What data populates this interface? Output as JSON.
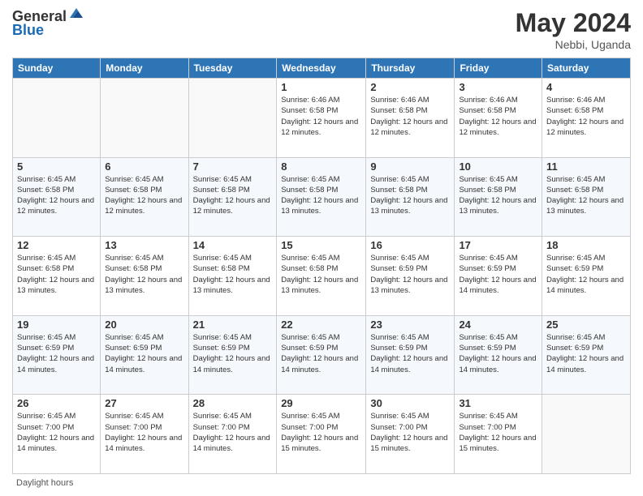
{
  "header": {
    "logo_general": "General",
    "logo_blue": "Blue",
    "month_year": "May 2024",
    "location": "Nebbi, Uganda"
  },
  "days_of_week": [
    "Sunday",
    "Monday",
    "Tuesday",
    "Wednesday",
    "Thursday",
    "Friday",
    "Saturday"
  ],
  "weeks": [
    [
      {
        "day": "",
        "info": ""
      },
      {
        "day": "",
        "info": ""
      },
      {
        "day": "",
        "info": ""
      },
      {
        "day": "1",
        "info": "Sunrise: 6:46 AM\nSunset: 6:58 PM\nDaylight: 12 hours\nand 12 minutes."
      },
      {
        "day": "2",
        "info": "Sunrise: 6:46 AM\nSunset: 6:58 PM\nDaylight: 12 hours\nand 12 minutes."
      },
      {
        "day": "3",
        "info": "Sunrise: 6:46 AM\nSunset: 6:58 PM\nDaylight: 12 hours\nand 12 minutes."
      },
      {
        "day": "4",
        "info": "Sunrise: 6:46 AM\nSunset: 6:58 PM\nDaylight: 12 hours\nand 12 minutes."
      }
    ],
    [
      {
        "day": "5",
        "info": "Sunrise: 6:45 AM\nSunset: 6:58 PM\nDaylight: 12 hours\nand 12 minutes."
      },
      {
        "day": "6",
        "info": "Sunrise: 6:45 AM\nSunset: 6:58 PM\nDaylight: 12 hours\nand 12 minutes."
      },
      {
        "day": "7",
        "info": "Sunrise: 6:45 AM\nSunset: 6:58 PM\nDaylight: 12 hours\nand 12 minutes."
      },
      {
        "day": "8",
        "info": "Sunrise: 6:45 AM\nSunset: 6:58 PM\nDaylight: 12 hours\nand 13 minutes."
      },
      {
        "day": "9",
        "info": "Sunrise: 6:45 AM\nSunset: 6:58 PM\nDaylight: 12 hours\nand 13 minutes."
      },
      {
        "day": "10",
        "info": "Sunrise: 6:45 AM\nSunset: 6:58 PM\nDaylight: 12 hours\nand 13 minutes."
      },
      {
        "day": "11",
        "info": "Sunrise: 6:45 AM\nSunset: 6:58 PM\nDaylight: 12 hours\nand 13 minutes."
      }
    ],
    [
      {
        "day": "12",
        "info": "Sunrise: 6:45 AM\nSunset: 6:58 PM\nDaylight: 12 hours\nand 13 minutes."
      },
      {
        "day": "13",
        "info": "Sunrise: 6:45 AM\nSunset: 6:58 PM\nDaylight: 12 hours\nand 13 minutes."
      },
      {
        "day": "14",
        "info": "Sunrise: 6:45 AM\nSunset: 6:58 PM\nDaylight: 12 hours\nand 13 minutes."
      },
      {
        "day": "15",
        "info": "Sunrise: 6:45 AM\nSunset: 6:58 PM\nDaylight: 12 hours\nand 13 minutes."
      },
      {
        "day": "16",
        "info": "Sunrise: 6:45 AM\nSunset: 6:59 PM\nDaylight: 12 hours\nand 13 minutes."
      },
      {
        "day": "17",
        "info": "Sunrise: 6:45 AM\nSunset: 6:59 PM\nDaylight: 12 hours\nand 14 minutes."
      },
      {
        "day": "18",
        "info": "Sunrise: 6:45 AM\nSunset: 6:59 PM\nDaylight: 12 hours\nand 14 minutes."
      }
    ],
    [
      {
        "day": "19",
        "info": "Sunrise: 6:45 AM\nSunset: 6:59 PM\nDaylight: 12 hours\nand 14 minutes."
      },
      {
        "day": "20",
        "info": "Sunrise: 6:45 AM\nSunset: 6:59 PM\nDaylight: 12 hours\nand 14 minutes."
      },
      {
        "day": "21",
        "info": "Sunrise: 6:45 AM\nSunset: 6:59 PM\nDaylight: 12 hours\nand 14 minutes."
      },
      {
        "day": "22",
        "info": "Sunrise: 6:45 AM\nSunset: 6:59 PM\nDaylight: 12 hours\nand 14 minutes."
      },
      {
        "day": "23",
        "info": "Sunrise: 6:45 AM\nSunset: 6:59 PM\nDaylight: 12 hours\nand 14 minutes."
      },
      {
        "day": "24",
        "info": "Sunrise: 6:45 AM\nSunset: 6:59 PM\nDaylight: 12 hours\nand 14 minutes."
      },
      {
        "day": "25",
        "info": "Sunrise: 6:45 AM\nSunset: 6:59 PM\nDaylight: 12 hours\nand 14 minutes."
      }
    ],
    [
      {
        "day": "26",
        "info": "Sunrise: 6:45 AM\nSunset: 7:00 PM\nDaylight: 12 hours\nand 14 minutes."
      },
      {
        "day": "27",
        "info": "Sunrise: 6:45 AM\nSunset: 7:00 PM\nDaylight: 12 hours\nand 14 minutes."
      },
      {
        "day": "28",
        "info": "Sunrise: 6:45 AM\nSunset: 7:00 PM\nDaylight: 12 hours\nand 14 minutes."
      },
      {
        "day": "29",
        "info": "Sunrise: 6:45 AM\nSunset: 7:00 PM\nDaylight: 12 hours\nand 15 minutes."
      },
      {
        "day": "30",
        "info": "Sunrise: 6:45 AM\nSunset: 7:00 PM\nDaylight: 12 hours\nand 15 minutes."
      },
      {
        "day": "31",
        "info": "Sunrise: 6:45 AM\nSunset: 7:00 PM\nDaylight: 12 hours\nand 15 minutes."
      },
      {
        "day": "",
        "info": ""
      }
    ]
  ],
  "footer": {
    "note": "Daylight hours"
  }
}
